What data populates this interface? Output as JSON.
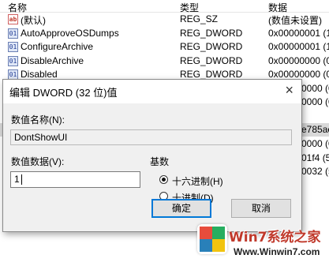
{
  "header": {
    "col_name": "名称",
    "col_type": "类型",
    "col_data": "数据"
  },
  "rows": [
    {
      "icon": "ab",
      "name": "(默认)",
      "type": "REG_SZ",
      "data": "(数值未设置)"
    },
    {
      "icon": "dword",
      "name": "AutoApproveOSDumps",
      "type": "REG_DWORD",
      "data": "0x00000001 (1"
    },
    {
      "icon": "dword",
      "name": "ConfigureArchive",
      "type": "REG_DWORD",
      "data": "0x00000001 (1"
    },
    {
      "icon": "dword",
      "name": "DisableArchive",
      "type": "REG_DWORD",
      "data": "0x00000000 (0"
    },
    {
      "icon": "dword",
      "name": "Disabled",
      "type": "REG_DWORD",
      "data": "0x00000000 (0"
    }
  ],
  "right_fragments": [
    "0000 (0",
    "0000 (0",
    "e785ac",
    "0000 (0",
    "01f4 (5",
    "0032 (5"
  ],
  "dialog": {
    "title": "编辑 DWORD (32 位)值",
    "close_glyph": "×",
    "value_name_label": "数值名称(N):",
    "value_name": "DontShowUI",
    "value_data_label": "数值数据(V):",
    "value_data": "1",
    "base_label": "基数",
    "base_options": [
      {
        "label": "十六进制(H)",
        "selected": true
      },
      {
        "label": "十进制(D)",
        "selected": false
      }
    ],
    "ok_label": "确定",
    "cancel_label": "取消"
  },
  "watermark": {
    "text": "Win7系统之家",
    "url": "Www.Winwin7.com"
  }
}
